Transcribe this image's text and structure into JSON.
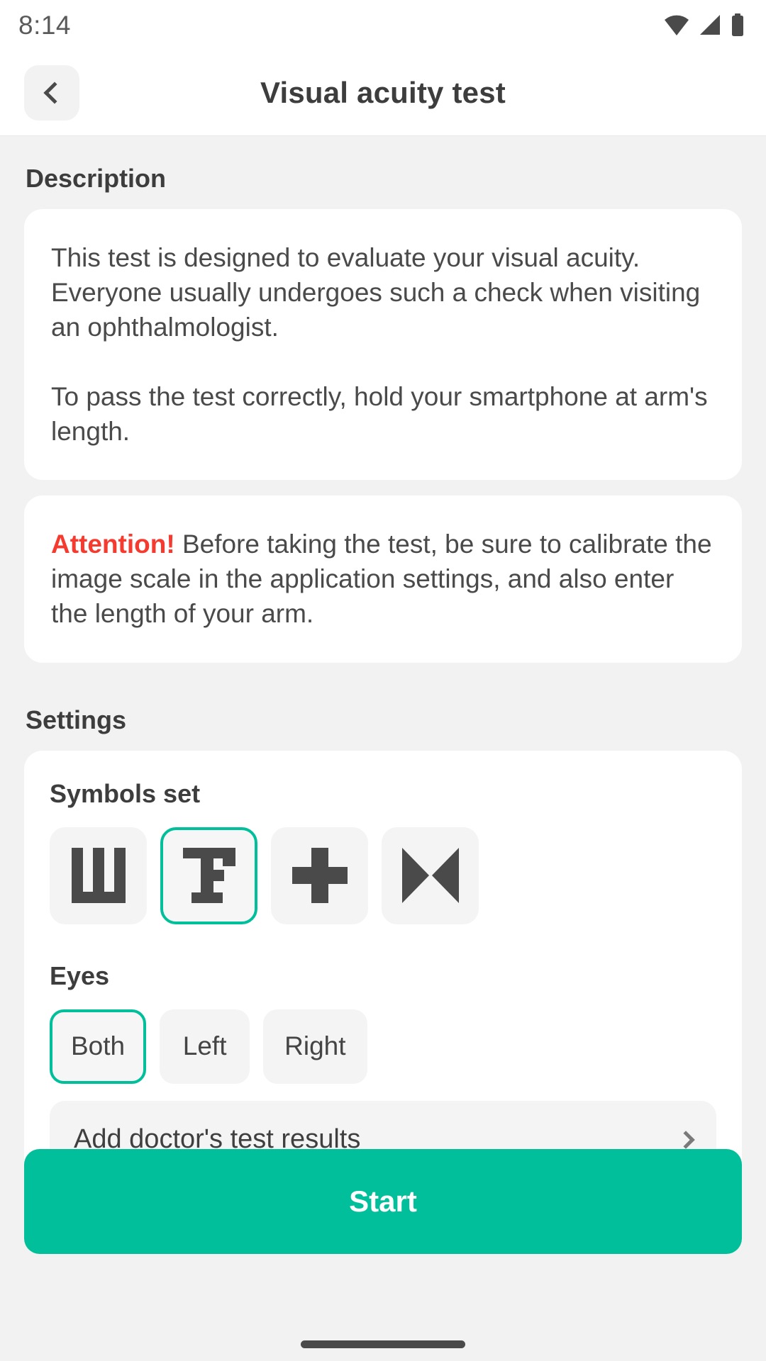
{
  "status_bar": {
    "time": "8:14",
    "icons": [
      "wifi-icon",
      "signal-icon",
      "battery-icon"
    ]
  },
  "app_bar": {
    "title": "Visual acuity test",
    "back_icon": "chevron-left-icon"
  },
  "description": {
    "heading": "Description",
    "paragraph_1": "This test is designed to evaluate your visual acuity. Everyone usually undergoes such a check when visiting an ophthalmologist.",
    "paragraph_2": "To pass the test correctly, hold your smartphone at arm's length.",
    "attention": {
      "label": "Attention!",
      "label_color": "#f53b30",
      "text": " Before taking the test, be sure to calibrate the image scale in the application settings, and also enter the length of your arm."
    }
  },
  "settings": {
    "heading": "Settings",
    "symbols_set": {
      "label": "Symbols set",
      "selected_index": 1,
      "options": [
        {
          "name": "sha-symbol",
          "glyph": "Ш"
        },
        {
          "name": "snellen-f-symbol",
          "glyph": "F"
        },
        {
          "name": "plus-symbol",
          "glyph": "+"
        },
        {
          "name": "bowtie-symbol",
          "glyph": "⋈"
        }
      ]
    },
    "eyes": {
      "label": "Eyes",
      "selected_index": 0,
      "options": [
        "Both",
        "Left",
        "Right"
      ]
    }
  },
  "doctor_results": {
    "label": "Add doctor's test results",
    "chevron_icon": "chevron-right-icon"
  },
  "start_button": {
    "label": "Start",
    "color": "#00bf9a"
  },
  "theme": {
    "accent": "#00bf9a",
    "danger": "#f53b30",
    "page_bg": "#f2f2f2",
    "card_bg": "#ffffff",
    "text": "#3d3d3d"
  }
}
